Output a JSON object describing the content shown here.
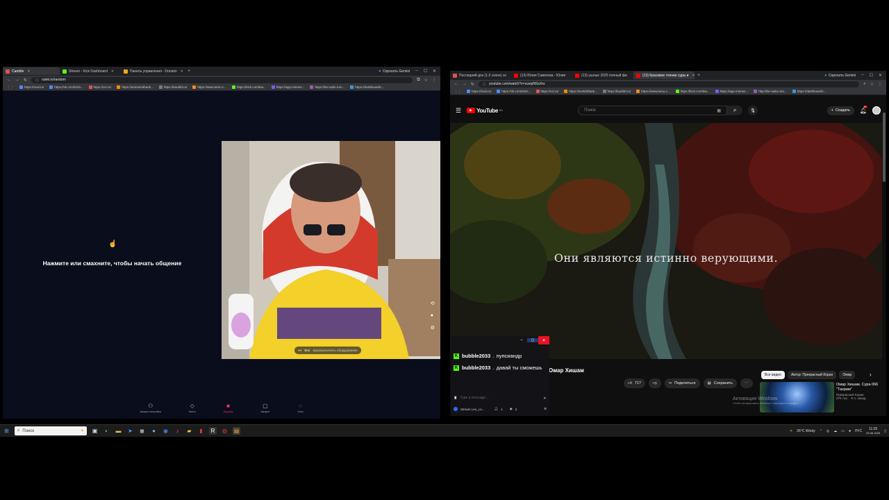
{
  "left_window": {
    "tabs": [
      {
        "label": "Camble",
        "color": "#e05252",
        "active": true
      },
      {
        "label": "Stream - Kick Dashboard",
        "color": "#53fc18",
        "active": false
      },
      {
        "label": "Панель управления - Donatio",
        "color": "#f5a623",
        "active": false
      }
    ],
    "gemini_label": "Спросить Gemini",
    "url": "ruletr.tv/random",
    "bookmarks": [
      "https://mail.ru/",
      "https://vk.com/id19...",
      "https://ozi.ru/",
      "https://anime/edhank...",
      "https://kaufdd.ru/",
      "https://www.temu.c...",
      "https://kick.com/lea...",
      "https://app.minnes...",
      "https://be-radio.ru/o...",
      "https://dashboard/c..."
    ],
    "prompt_text": "Нажмите или смахните, чтобы начать общение",
    "cam_pill_label": "Все",
    "cam_pill_hint": "звуковыполнять оборудования",
    "nav": [
      "Аккаунт-настройки",
      "Лента",
      "Ищущие",
      "Аккаунт",
      "Чаты"
    ]
  },
  "right_window": {
    "tabs": [
      {
        "label": "Последний доз (1-2 сезон) се",
        "color": "#e05252",
        "active": false
      },
      {
        "label": "(13) Юлия Савичева - Юлия",
        "color": "#ff0000",
        "active": false
      },
      {
        "label": "(13) ушлые 2025 полный фи",
        "color": "#ff0000",
        "active": false
      },
      {
        "label": "(13) Красивое чтение суры и",
        "color": "#ff0000",
        "active": true
      }
    ],
    "gemini_label": "Спросить Gemini",
    "url": "youtube.com/watch?v=zuvqrNSsXrs",
    "bookmarks": [
      "https://mail.ru/",
      "https://vk.com/id19...",
      "https://ozi.ru/",
      "https://worldoftank...",
      "https://kaufdd.ru/",
      "https://www.temu.c...",
      "https://kick.com/lea...",
      "https://app.minnes...",
      "http://be-radio.ru/o...",
      "https://dashboard/c..."
    ],
    "yt_logo": "YouTube",
    "yt_logo_sup": "RU",
    "search_placeholder": "Поиск",
    "create_label": "Создать",
    "notif_count": "9+",
    "video_subtitle": "Они являются истинно верующими.",
    "video_title": "Омар Хишам",
    "likes": "717",
    "share_label": "Поделиться",
    "save_label": "Сохранить",
    "chips": [
      "Все видео",
      "Автор: Прекрасный Коран",
      "Омар"
    ],
    "rec_title": "Омар Хишам. Сура 066 \"Тахрим\"",
    "rec_channel": "Прекрасный Коран",
    "rec_meta": "276 тыс. · 9 л. назад",
    "activation_title": "Активация Windows",
    "activation_sub": "Чтобы активировать Windows, перейдите в раздел..."
  },
  "chat": {
    "messages": [
      {
        "user": "bubble2033",
        "text": "пупсиандр"
      },
      {
        "user": "bubble2033",
        "text": "давай ты сможешь"
      }
    ],
    "input_placeholder": "Type a message...",
    "stream_label": "Stream Leo_Le...",
    "count1": "1",
    "count2": "2"
  },
  "taskbar": {
    "search_placeholder": "Поиск",
    "weather": "26°C  Windy",
    "lang": "РУС",
    "time": "11:25",
    "date": "03.06.2025"
  }
}
